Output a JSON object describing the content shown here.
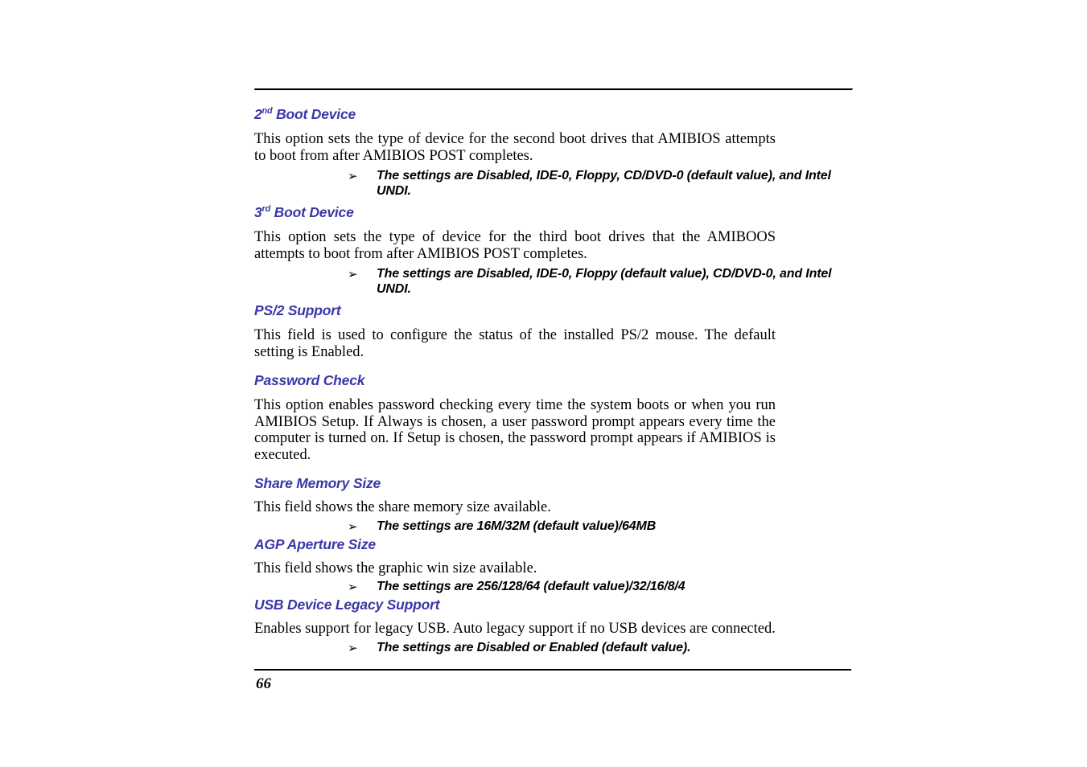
{
  "page": {
    "number": "66",
    "bullet_glyph": "➢"
  },
  "sections": [
    {
      "heading_prefix": "2",
      "heading_sup": "nd",
      "heading_rest": " Boot Device",
      "heading_plain": "2nd Boot Device",
      "body": "This option sets the type of device for the second boot drives that AMIBIOS attempts to boot from after AMIBIOS POST completes.",
      "bullet": "The settings are Disabled, IDE-0, Floppy, CD/DVD-0 (default value), and Intel UNDI."
    },
    {
      "heading_prefix": "3",
      "heading_sup": "rd",
      "heading_rest": " Boot Device",
      "heading_plain": "3rd Boot Device",
      "body": "This option sets the type of device for the third boot drives that the AMIBOOS attempts to boot from after AMIBIOS POST completes.",
      "bullet": "The settings are Disabled, IDE-0, Floppy (default value), CD/DVD-0, and Intel UNDI."
    },
    {
      "heading_plain": "PS/2 Support",
      "body": "This field is used to configure the status of the installed PS/2 mouse.  The default setting is Enabled.",
      "bullet": null
    },
    {
      "heading_plain": "Password Check",
      "body": "This option enables password checking every time the system boots or when you run AMIBIOS Setup.  If Always is chosen, a user password prompt appears every time the computer is turned on.  If Setup is chosen, the password prompt appears if AMIBIOS is executed.",
      "bullet": null
    },
    {
      "heading_plain": "Share Memory Size",
      "body": "This field shows the share memory size available.",
      "bullet": "The settings are 16M/32M (default value)/64MB"
    },
    {
      "heading_plain": "AGP Aperture Size",
      "body": "This field shows the graphic win size available.",
      "bullet": "The settings are 256/128/64 (default value)/32/16/8/4"
    },
    {
      "heading_plain": "USB Device Legacy Support",
      "body": "Enables support for legacy USB.  Auto legacy support if no USB devices are connected.",
      "bullet": "The settings are Disabled or Enabled (default value)."
    }
  ],
  "colors": {
    "heading": "#3b36a8",
    "body": "#000000",
    "rule": "#000000",
    "background": "#ffffff"
  }
}
